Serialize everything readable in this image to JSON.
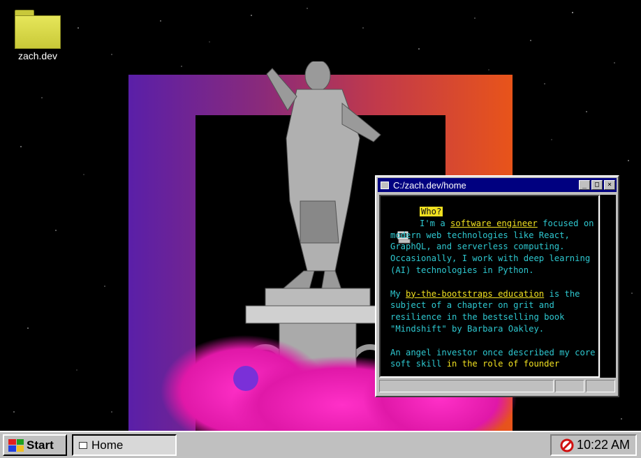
{
  "desktop": {
    "icon_label": "zach.dev"
  },
  "window": {
    "title": "C:/zach.dev/home",
    "controls": {
      "minimize": "_",
      "maximize": "□",
      "close": "×"
    },
    "content": {
      "heading": "Who?",
      "p1_a": "I'm a ",
      "p1_link": "software engineer",
      "p1_b": " focused on modern web technologies like React, GraphQL, and serverless computing. Occasionally, I work with deep learning (AI) technologies in Python.",
      "p2_a": "My ",
      "p2_link": "by-the-bootstraps education",
      "p2_b": " is the subject of a chapter on grit and resilience in the bestselling book \"Mindshift\" by Barbara Oakley.",
      "p3_a": "An angel investor once described my core soft skill ",
      "p3_y": "in the",
      "p3_b": " ",
      "p3_link": "role of founder"
    }
  },
  "taskbar": {
    "start_label": "Start",
    "task_label": "Home",
    "clock": "10:22 AM"
  },
  "colors": {
    "text": "#2ec8d0",
    "highlight": "#f0e020",
    "titlebar": "#000080",
    "chrome": "#c0c0c0"
  }
}
